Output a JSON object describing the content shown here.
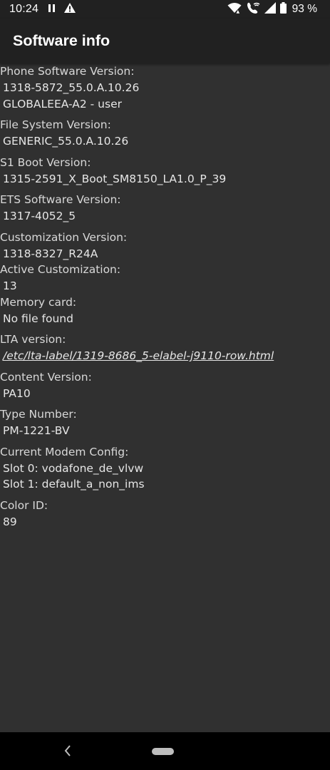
{
  "status_bar": {
    "time": "10:24",
    "battery_percent": "93 %",
    "icons": [
      "pause-icon",
      "warning-icon",
      "wifi-icon",
      "wifi-calling-icon",
      "signal-icon",
      "battery-icon"
    ]
  },
  "app_bar": {
    "title": "Software info"
  },
  "info": {
    "phone_software": {
      "label": "Phone Software Version:",
      "values": [
        "1318-5872_55.0.A.10.26",
        "GLOBALEEA-A2 - user"
      ]
    },
    "file_system": {
      "label": "File System Version:",
      "values": [
        "GENERIC_55.0.A.10.26"
      ]
    },
    "s1_boot": {
      "label": "S1 Boot Version:",
      "values": [
        "1315-2591_X_Boot_SM8150_LA1.0_P_39"
      ]
    },
    "ets_software": {
      "label": "ETS Software Version:",
      "values": [
        "1317-4052_5"
      ]
    },
    "customization": {
      "label": "Customization Version:",
      "values": [
        "1318-8327_R24A"
      ]
    },
    "active_customization": {
      "label": "Active Customization:",
      "values": [
        "13"
      ]
    },
    "memory_card": {
      "label": "Memory card:",
      "values": [
        "No file found"
      ]
    },
    "lta_version": {
      "label": "LTA version:",
      "values": [
        "/etc/lta-label/1319-8686_5-elabel-j9110-row.html"
      ]
    },
    "content_version": {
      "label": "Content Version:",
      "values": [
        "PA10"
      ]
    },
    "type_number": {
      "label": "Type Number:",
      "values": [
        "PM-1221-BV"
      ]
    },
    "modem_config": {
      "label": "Current Modem Config:",
      "values": [
        "Slot 0: vodafone_de_vlvw",
        "Slot 1: default_a_non_ims"
      ]
    },
    "color_id": {
      "label": "Color ID:",
      "values": [
        "89"
      ]
    }
  },
  "nav_bar": {
    "icons": [
      "back-icon",
      "home-pill-icon"
    ]
  },
  "colors": {
    "background": "#303030",
    "app_bar": "#212121",
    "text": "#dcdcdc",
    "nav_bar": "#000000"
  }
}
